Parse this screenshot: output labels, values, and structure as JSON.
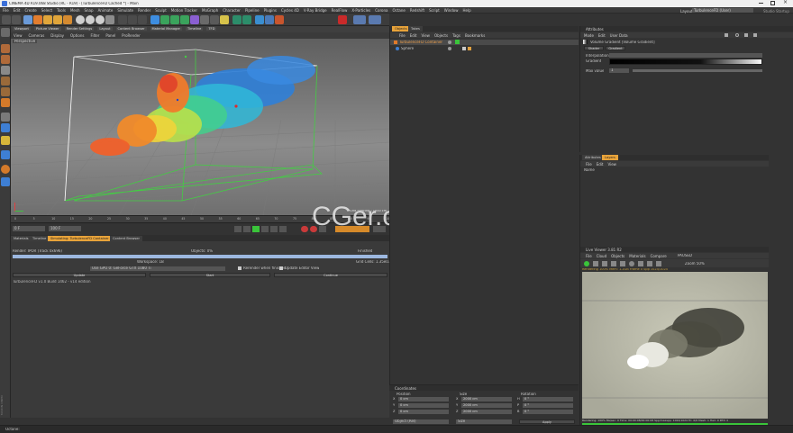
{
  "window": {
    "title": "CINEMA 4D R19.068 Studio (RC - R19) - [TurbulenceFD Cached *] - Main"
  },
  "menubar": {
    "items": [
      "File",
      "Edit",
      "Create",
      "Select",
      "Tools",
      "Mesh",
      "Snap",
      "Animate",
      "Simulate",
      "Render",
      "Sculpt",
      "Motion Tracker",
      "MoGraph",
      "Character",
      "Pipeline",
      "Plugins",
      "Cycles 4D",
      "V-Ray Bridge",
      "RealFlow",
      "X-Particles",
      "Corona",
      "Octane",
      "Redshift",
      "Script",
      "Window",
      "Help"
    ],
    "layout_label": "Layout:",
    "layout_value": "TurbulenceFD (User)",
    "brand": "Studio Startup"
  },
  "viewport": {
    "menu": [
      "View",
      "Cameras",
      "Display",
      "Options",
      "Filter",
      "Panel",
      "ProRender"
    ],
    "tabs": [
      "Viewport",
      "Picture Viewer",
      "Render Settings",
      "Layout",
      "Content Browser",
      "Material Manager",
      "Timeline",
      "TFD"
    ],
    "label": "Perspective",
    "grid_spacing": "Grid Spacing : 1000 cm"
  },
  "timeline": {
    "ticks": [
      "0",
      "5",
      "10",
      "15",
      "20",
      "25",
      "30",
      "35",
      "40",
      "45",
      "50",
      "55",
      "60",
      "65",
      "70",
      "75",
      "80",
      "85",
      "90",
      "95",
      "100"
    ],
    "frame_start": "0 F",
    "frame_end": "100 F",
    "current": "0 F"
  },
  "bottom_tabs": [
    "Materials",
    "Timeline",
    "Simulating: TurbulenceFD Container",
    "Content Browser"
  ],
  "render_panel": {
    "render_label": "Render: IPOR (Track 0x696)",
    "objects_label": "Objects: 0%",
    "finished": "Finished",
    "bar_percent": 100,
    "workspace_label": "Workspace: 1B",
    "grid_cells": "Grid Cells: 1.35e07",
    "device": "Use GPU 0: GeForce GTX 1080 Ti",
    "rerender": "Rerender when finished",
    "update_editor": "Update Editor View",
    "buttons": [
      "Update",
      "Start",
      "Continue"
    ],
    "log": "TurbulenceFD v1.0 Build 1462 - v14 edition"
  },
  "objects": {
    "tabs": [
      "Objects",
      "Takes"
    ],
    "menu": [
      "File",
      "Edit",
      "View",
      "Objects",
      "Tags",
      "Bookmarks"
    ],
    "items": [
      "TurbulenceFD Container",
      "Sphere"
    ]
  },
  "coordinates": {
    "title": "Coordinates",
    "headers": [
      "Position",
      "Size",
      "Rotation"
    ],
    "rows": [
      [
        "X",
        "0 cm",
        "X",
        "2000 cm",
        "H",
        "0 °"
      ],
      [
        "Y",
        "0 cm",
        "Y",
        "2000 cm",
        "P",
        "0 °"
      ],
      [
        "Z",
        "0 cm",
        "Z",
        "2000 cm",
        "B",
        "0 °"
      ]
    ],
    "mode_left": "Object (Rel)",
    "mode_mid": "Size",
    "apply": "Apply"
  },
  "attributes": {
    "title": "Attributes",
    "menu": [
      "Mode",
      "Edit",
      "User Data"
    ],
    "object_label": "Volume Gradient [Volume Gradient]",
    "tabs": [
      "Shader",
      "Gradient"
    ],
    "rows": [
      "Interpolation",
      "Gradient",
      "Max value"
    ],
    "max_value": "1"
  },
  "layers": {
    "tabs": [
      "Attributes",
      "Layers"
    ],
    "menu": [
      "File",
      "Edit",
      "View"
    ],
    "name_col": "Name"
  },
  "preview": {
    "title": "Live Viewer 3.81 R2",
    "menu": [
      "File",
      "Cloud",
      "Objects",
      "Materials",
      "Compare"
    ],
    "status": "PAUSED",
    "zoom": "Zoom 50%",
    "stats_line": "Rendering 100% Mem: 1.2GB  Frame 0  Spp 1024/1024",
    "strip": "Rendering: 100%  Ms/sec: 0  Time: 00:00:08/00:00:08  Spp/maxspp: 1024/1024  Tri: 0/0  Mesh: 1  Hair: 0  RTX: 0"
  },
  "watermark": "CGer.com",
  "statusbar": {
    "text": "Octane:"
  },
  "colors": {
    "accent": "#e8a33a",
    "bg": "#333333",
    "active_green": "#3ac43a"
  }
}
